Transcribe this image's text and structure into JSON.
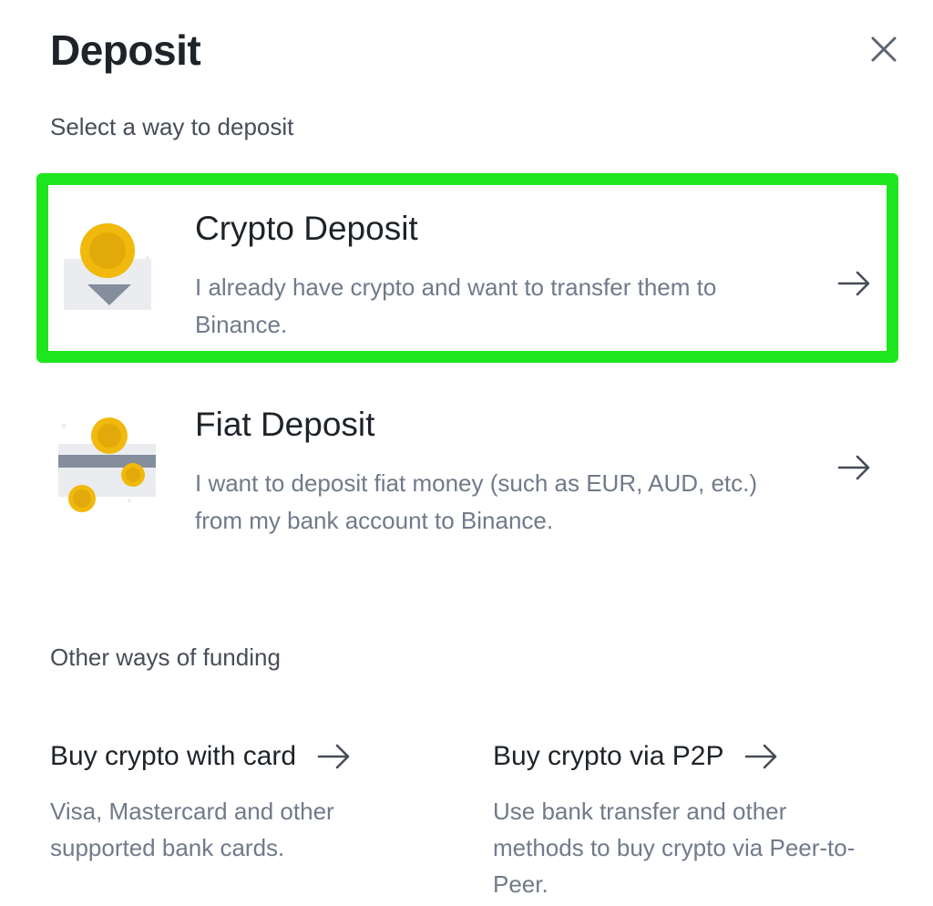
{
  "header": {
    "title": "Deposit",
    "close_icon": "close-icon"
  },
  "subtitle": "Select a way to deposit",
  "options": [
    {
      "title": "Crypto Deposit",
      "description": "I already have crypto and want to transfer them to Binance.",
      "icon": "crypto-deposit-illustration",
      "arrow_icon": "arrow-right-icon",
      "highlighted": true
    },
    {
      "title": "Fiat Deposit",
      "description": "I want to deposit fiat money (such as EUR, AUD, etc.) from my bank account to Binance.",
      "icon": "fiat-deposit-illustration",
      "arrow_icon": "arrow-right-icon",
      "highlighted": false
    }
  ],
  "other": {
    "heading": "Other ways of funding",
    "items": [
      {
        "title": "Buy crypto with card",
        "description": "Visa, Mastercard and other supported bank cards."
      },
      {
        "title": "Buy crypto via P2P",
        "description": "Use bank transfer and other methods to buy crypto via Peer-to-Peer."
      }
    ]
  },
  "colors": {
    "highlight_border": "#1EE61E",
    "coin": "#F0B90B",
    "text_primary": "#1E2329",
    "text_secondary": "#707A8A"
  }
}
